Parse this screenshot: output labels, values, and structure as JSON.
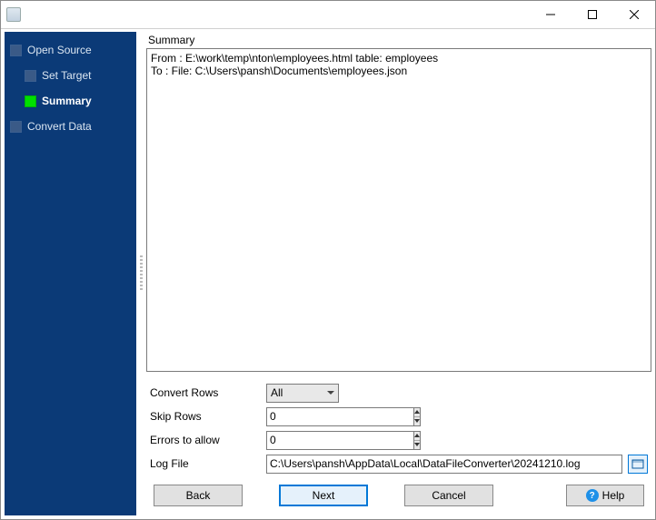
{
  "titlebar": {
    "title": ""
  },
  "sidebar": {
    "items": [
      {
        "label": "Open Source",
        "indent": 0,
        "current": false
      },
      {
        "label": "Set Target",
        "indent": 1,
        "current": false
      },
      {
        "label": "Summary",
        "indent": 1,
        "current": true
      },
      {
        "label": "Convert Data",
        "indent": 0,
        "current": false
      }
    ]
  },
  "panel": {
    "summary_label": "Summary",
    "summary_text": "From : E:\\work\\temp\\nton\\employees.html table: employees\nTo : File: C:\\Users\\pansh\\Documents\\employees.json"
  },
  "form": {
    "convert_rows_label": "Convert Rows",
    "convert_rows_value": "All",
    "skip_rows_label": "Skip Rows",
    "skip_rows_value": "0",
    "errors_label": "Errors to allow",
    "errors_value": "0",
    "log_label": "Log File",
    "log_value": "C:\\Users\\pansh\\AppData\\Local\\DataFileConverter\\20241210.log"
  },
  "buttons": {
    "back": "Back",
    "next": "Next",
    "cancel": "Cancel",
    "help": "Help"
  }
}
